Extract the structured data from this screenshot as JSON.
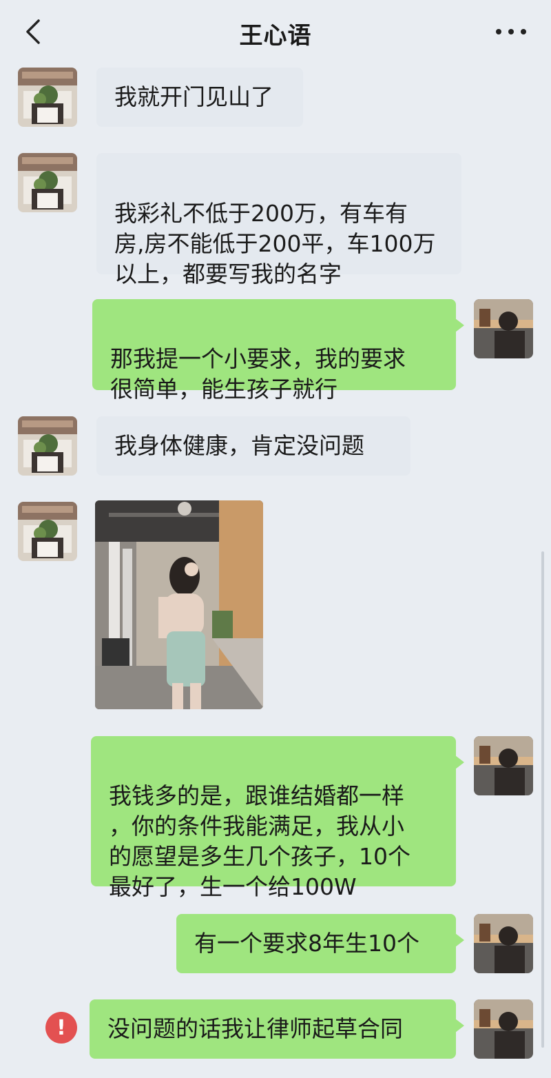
{
  "header": {
    "title": "王心语",
    "back_icon": "chevron-left-icon",
    "more_icon": "more-horizontal-icon"
  },
  "messages": [
    {
      "text": "我就开门见山了"
    },
    {
      "text": "我彩礼不低于200万，有车有\n房,房不能低于200平，车100万\n以上，都要写我的名字"
    },
    {
      "text": "那我提一个小要求，我的要求\n很简单，能生孩子就行"
    },
    {
      "text": "我身体健康，肯定没问题"
    },
    {
      "text": "我钱多的是，跟谁结婚都一样\n，你的条件我能满足，我从小\n的愿望是多生几个孩子，10个\n最好了，生一个给100W"
    },
    {
      "text": "有一个要求8年生10个"
    },
    {
      "text": "没问题的话我让律师起草合同"
    }
  ],
  "status": {
    "error_icon": "exclamation-circle-icon",
    "error_glyph": "!"
  },
  "colors": {
    "background": "#e9edf2",
    "incoming_bubble": "#e4e9ef",
    "outgoing_bubble": "#9fe57f",
    "error": "#e35151"
  }
}
